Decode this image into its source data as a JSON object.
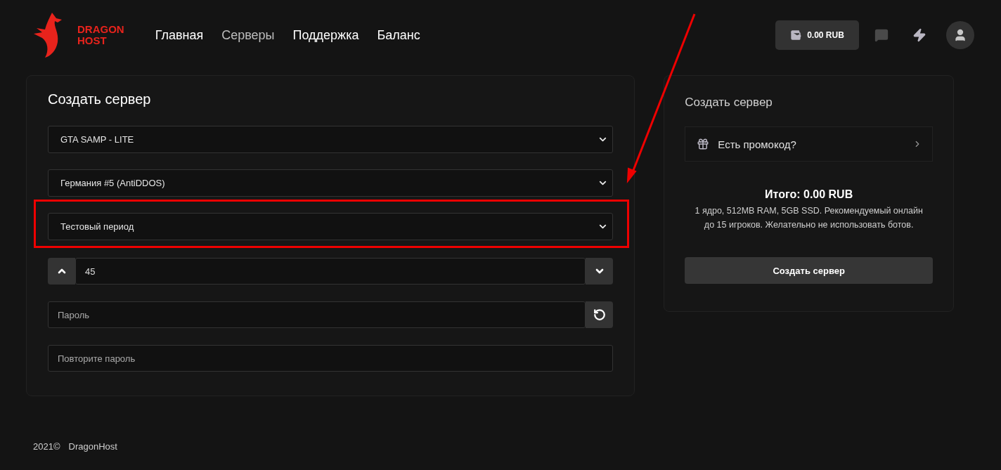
{
  "logo": {
    "line1": "DRAGON",
    "line2": "HOST"
  },
  "nav": [
    {
      "label": "Главная",
      "selected": false
    },
    {
      "label": "Серверы",
      "selected": true
    },
    {
      "label": "Поддержка",
      "selected": false
    },
    {
      "label": "Баланс",
      "selected": false
    }
  ],
  "balance": "0.00 RUB",
  "form": {
    "title": "Создать сервер",
    "selects": [
      {
        "value": "GTA SAMP - LITE",
        "highlighted": false
      },
      {
        "value": "Германия #5 (AntiDDOS)",
        "highlighted": false
      },
      {
        "value": "Тестовый период",
        "highlighted": true
      }
    ],
    "slots": "45",
    "password": {
      "placeholder": "Пароль"
    },
    "repeat_password": {
      "placeholder": "Повторите пароль"
    }
  },
  "summary": {
    "title": "Создать сервер",
    "promo": "Есть промокод?",
    "total": "Итого: 0.00 RUB",
    "description": "1 ядро, 512MB RAM, 5GB SSD. Рекомендуемый онлайн до 15 игроков. Желательно не использовать ботов.",
    "button": "Создать сервер"
  },
  "footer": {
    "year": "2021©",
    "name": "DragonHost"
  }
}
